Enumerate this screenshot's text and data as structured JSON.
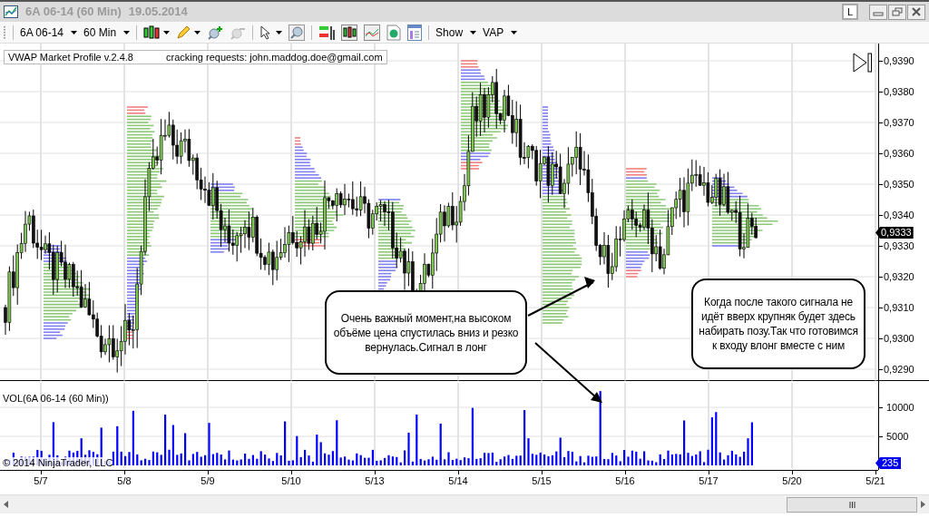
{
  "window": {
    "title": "6A 06-14 (60 Min)",
    "date": "19.05.2014",
    "link_button": "L"
  },
  "toolbar": {
    "instrument": "6A 06-14",
    "interval": "60 Min",
    "show_menu": "Show",
    "vap_menu": "VAP"
  },
  "indicator": {
    "name": "VWAP Market Profile v.2.4.8",
    "note": "cracking requests: john.maddog.doe@gmail.com"
  },
  "price_axis": {
    "ticks": [
      "0,9390",
      "0,9380",
      "0,9370",
      "0,9360",
      "0,9350",
      "0,9340",
      "0,9330",
      "0,9320",
      "0,9310",
      "0,9300",
      "0,9290"
    ],
    "last_price": "0,9333"
  },
  "callouts": [
    {
      "text": "Очень важный момент,на высоком объёме цена спустилась вниз и резко вернулась.Сигнал в лонг"
    },
    {
      "text": "Когда после такого сигнала не идёт вверх крупняк будет здесь набирать позу.Так что готовимся к входу влонг вместе с ним"
    }
  ],
  "volume_panel": {
    "title": "VOL(6A 06-14 (60 Min))",
    "ticks": [
      "10000",
      "5000"
    ],
    "last_volume": "235",
    "copyright": "© 2014 NinjaTrader, LLC"
  },
  "date_axis": [
    "5/7",
    "5/8",
    "5/9",
    "5/10",
    "5/13",
    "5/14",
    "5/15",
    "5/16",
    "5/17",
    "5/20",
    "5/21"
  ]
}
